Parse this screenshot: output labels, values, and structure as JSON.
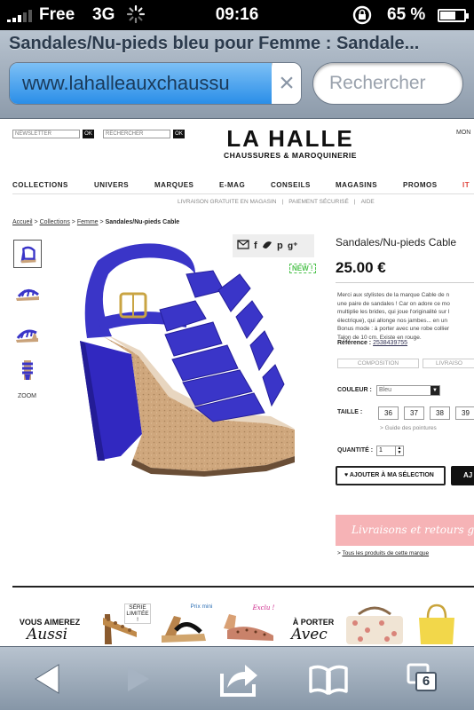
{
  "status_bar": {
    "carrier": "Free",
    "network": "3G",
    "time": "09:16",
    "battery_percent": "65 %",
    "battery_level": 0.65
  },
  "browser": {
    "page_title": "Sandales/Nu-pieds bleu pour Femme : Sandale...",
    "url": "www.lahalleauxchaussu",
    "search_placeholder": "Rechercher",
    "load_progress": 0.9,
    "tab_count": "6"
  },
  "site": {
    "newsletter_placeholder": "NEWSLETTER",
    "search_placeholder": "RECHERCHER",
    "ok_label": "OK",
    "logo_main": "LA HALLE",
    "logo_sub": "CHAUSSURES & MAROQUINERIE",
    "account_label": "MON",
    "nav": [
      "COLLECTIONS",
      "UNIVERS",
      "MARQUES",
      "E-MAG",
      "CONSEILS",
      "MAGASINS",
      "PROMOS",
      "IT"
    ],
    "subnav": [
      "LIVRAISON GRATUITE EN MAGASIN",
      "|",
      "PAIEMENT SÉCURISÉ",
      "|",
      "AIDE"
    ],
    "breadcrumb": {
      "home": "Accueil",
      "sep": ">",
      "collections": "Collections",
      "femme": "Femme",
      "current": "Sandales/Nu-pieds Cable"
    },
    "zoom_label": "ZOOM",
    "new_badge": "NEW !"
  },
  "product": {
    "name": "Sandales/Nu-pieds Cable",
    "price": "25.00 €",
    "description": [
      "Merci aux stylistes de la marque Cable de n",
      "une paire de sandales ! Car on adore ce mo",
      "multiplie les brides, qui joue l'originalité sur l",
      "électrique), qui allonge nos jambes... en un",
      "Bonus mode : à porter avec une robe collier",
      "Talon de 10 cm. Existe en rouge."
    ],
    "reference_label": "Référence :",
    "reference": "2538439755",
    "tabs": [
      "COMPOSITION",
      "LIVRAISO"
    ],
    "color_label": "COULEUR :",
    "color_value": "Bleu",
    "size_label": "TAILLE :",
    "sizes": [
      "36",
      "37",
      "38",
      "39"
    ],
    "size_guide": "> Guide des pointures",
    "quantity_label": "QUANTITÉ :",
    "quantity": "1",
    "add_selection": "AJOUTER À MA SÉLECTION",
    "add_cart": "AJ",
    "promo_banner": "Livraisons et retours grat",
    "all_brand_link": "Tous les produits de cette marque",
    "color_hex": "#3a35c8",
    "cork_hex": "#c9a27a"
  },
  "recommendations": {
    "left_title_1": "VOUS AIMEREZ",
    "left_title_2": "Aussi",
    "tag_serie_1": "SÉRIE",
    "tag_serie_2": "LIMITÉE !",
    "tag_prix": "Prix mini",
    "tag_exclu": "Exclu !",
    "right_title_1": "À PORTER",
    "right_title_2": "Avec"
  },
  "icons": {
    "share": [
      "envelope-icon",
      "facebook-icon",
      "twitter-icon",
      "pinterest-icon",
      "google-plus-icon"
    ],
    "toolbar": [
      "back-arrow-icon",
      "forward-arrow-icon",
      "share-action-icon",
      "bookmarks-book-icon",
      "tabs-icon"
    ]
  }
}
